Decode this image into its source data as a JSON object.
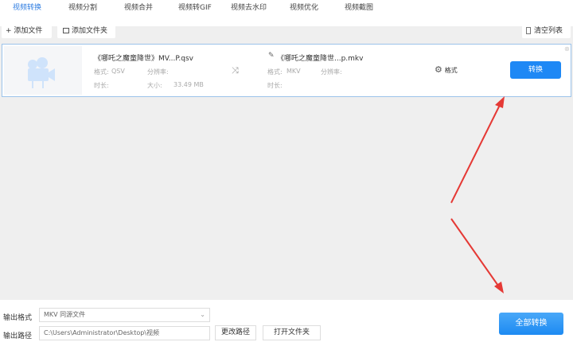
{
  "tabs": [
    "视频转换",
    "视频分割",
    "视频合并",
    "视频转GIF",
    "视频去水印",
    "视频优化",
    "视频截图"
  ],
  "toolbar": {
    "add_file": "+ 添加文件",
    "add_folder": "添加文件夹",
    "clear_list": "清空列表"
  },
  "item": {
    "source_name": "《哪吒之魔童降世》MV...P.qsv",
    "source_format_label": "格式:",
    "source_format": "QSV",
    "source_resolution_label": "分辨率:",
    "source_duration_label": "时长:",
    "size_label": "大小:",
    "size": "33.49 MB",
    "target_name": "《哪吒之魔童降世...p.mkv",
    "target_format_label": "格式:",
    "target_format": "MKV",
    "target_resolution_label": "分辨率:",
    "target_duration_label": "时长:",
    "format_button": "格式",
    "convert_button": "转换"
  },
  "bottom": {
    "output_format_label": "输出格式",
    "output_format_value": "MKV  同源文件",
    "output_path_label": "输出路径",
    "output_path_value": "C:\\Users\\Administrator\\Desktop\\视频",
    "change_path": "更改路径",
    "open_folder": "打开文件夹",
    "convert_all": "全部转换"
  },
  "colors": {
    "accent": "#1e88f5",
    "annotation_arrow": "#e53935"
  }
}
